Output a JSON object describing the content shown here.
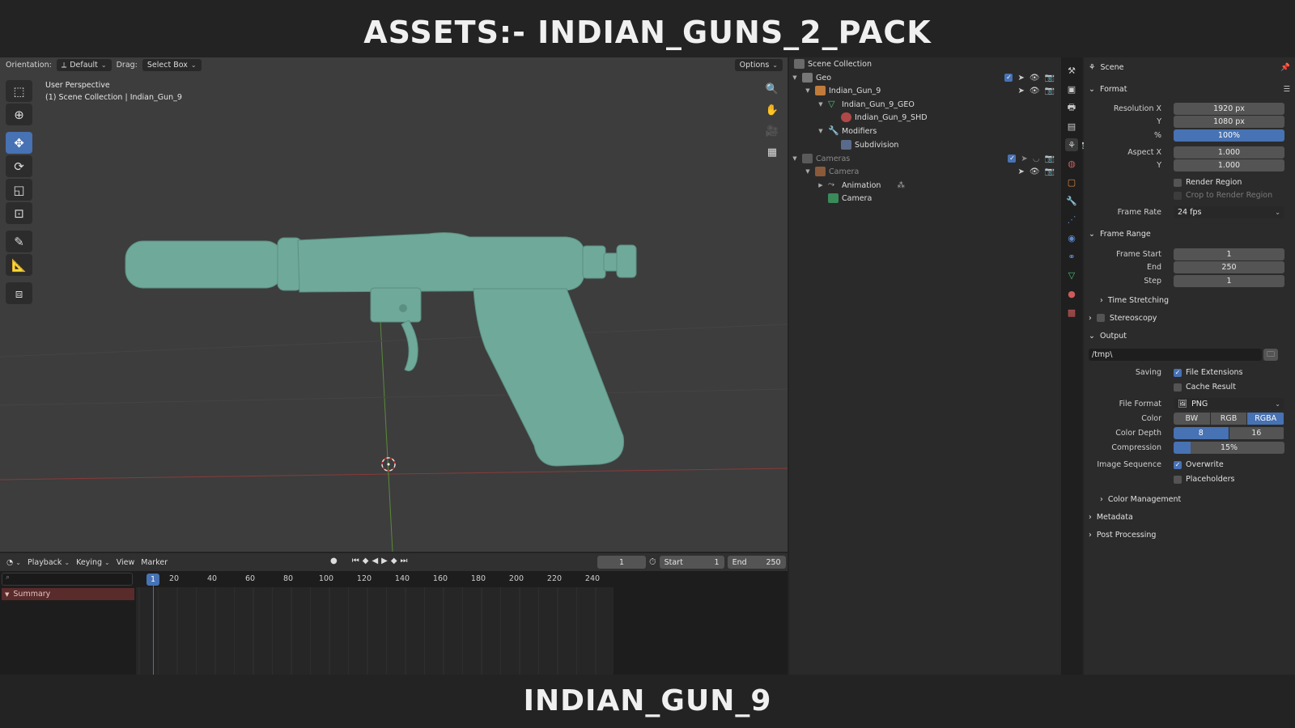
{
  "banners": {
    "top": "ASSETS:- INDIAN_GUNS_2_PACK",
    "bottom": "INDIAN_GUN_9"
  },
  "viewport": {
    "orientation_label": "Orientation:",
    "orientation_value": "Default",
    "drag_label": "Drag:",
    "drag_value": "Select Box",
    "options_label": "Options",
    "perspective": "User Perspective",
    "collection_info": "(1) Scene Collection | Indian_Gun_9"
  },
  "timeline": {
    "menus": [
      "Playback",
      "Keying",
      "View",
      "Marker"
    ],
    "current_frame": "1",
    "start_label": "Start",
    "start_value": "1",
    "end_label": "End",
    "end_value": "250",
    "ticks": [
      "20",
      "40",
      "60",
      "80",
      "100",
      "120",
      "140",
      "160",
      "180",
      "200",
      "220",
      "240"
    ],
    "summary_label": "Summary",
    "playhead_frame": "1"
  },
  "outliner": {
    "root": "Scene Collection",
    "items": [
      {
        "label": "Geo"
      },
      {
        "label": "Indian_Gun_9"
      },
      {
        "label": "Indian_Gun_9_GEO"
      },
      {
        "label": "Indian_Gun_9_SHD"
      },
      {
        "label": "Modifiers"
      },
      {
        "label": "Subdivision"
      },
      {
        "label": "Cameras"
      },
      {
        "label": "Camera"
      },
      {
        "label": "Animation"
      },
      {
        "label": "Camera"
      }
    ]
  },
  "properties": {
    "header": "Scene",
    "format": {
      "title": "Format",
      "resolution_x_label": "Resolution X",
      "resolution_x": "1920 px",
      "y_label": "Y",
      "resolution_y": "1080 px",
      "pct_label": "%",
      "resolution_pct": "100%",
      "aspect_x_label": "Aspect X",
      "aspect_x": "1.000",
      "aspect_y_label": "Y",
      "aspect_y": "1.000",
      "render_region": "Render Region",
      "crop_region": "Crop to Render Region",
      "frame_rate_label": "Frame Rate",
      "frame_rate": "24 fps"
    },
    "frame_range": {
      "title": "Frame Range",
      "start_label": "Frame Start",
      "start": "1",
      "end_label": "End",
      "end": "250",
      "step_label": "Step",
      "step": "1",
      "time_stretching": "Time Stretching"
    },
    "stereoscopy": "Stereoscopy",
    "output": {
      "title": "Output",
      "path": "/tmp\\",
      "saving_label": "Saving",
      "file_extensions": "File Extensions",
      "cache_result": "Cache Result",
      "file_format_label": "File Format",
      "file_format": "PNG",
      "color_label": "Color",
      "color_options": [
        "BW",
        "RGB",
        "RGBA"
      ],
      "depth_label": "Color Depth",
      "depth_options": [
        "8",
        "16"
      ],
      "compression_label": "Compression",
      "compression": "15%",
      "compression_fraction": 0.15,
      "sequence_label": "Image Sequence",
      "overwrite": "Overwrite",
      "placeholders": "Placeholders",
      "color_management": "Color Management"
    },
    "metadata": "Metadata",
    "post_processing": "Post Processing"
  },
  "colors": {
    "accent": "#4772b3",
    "gun": "#6fa99a",
    "summary": "#5a2b2b"
  }
}
